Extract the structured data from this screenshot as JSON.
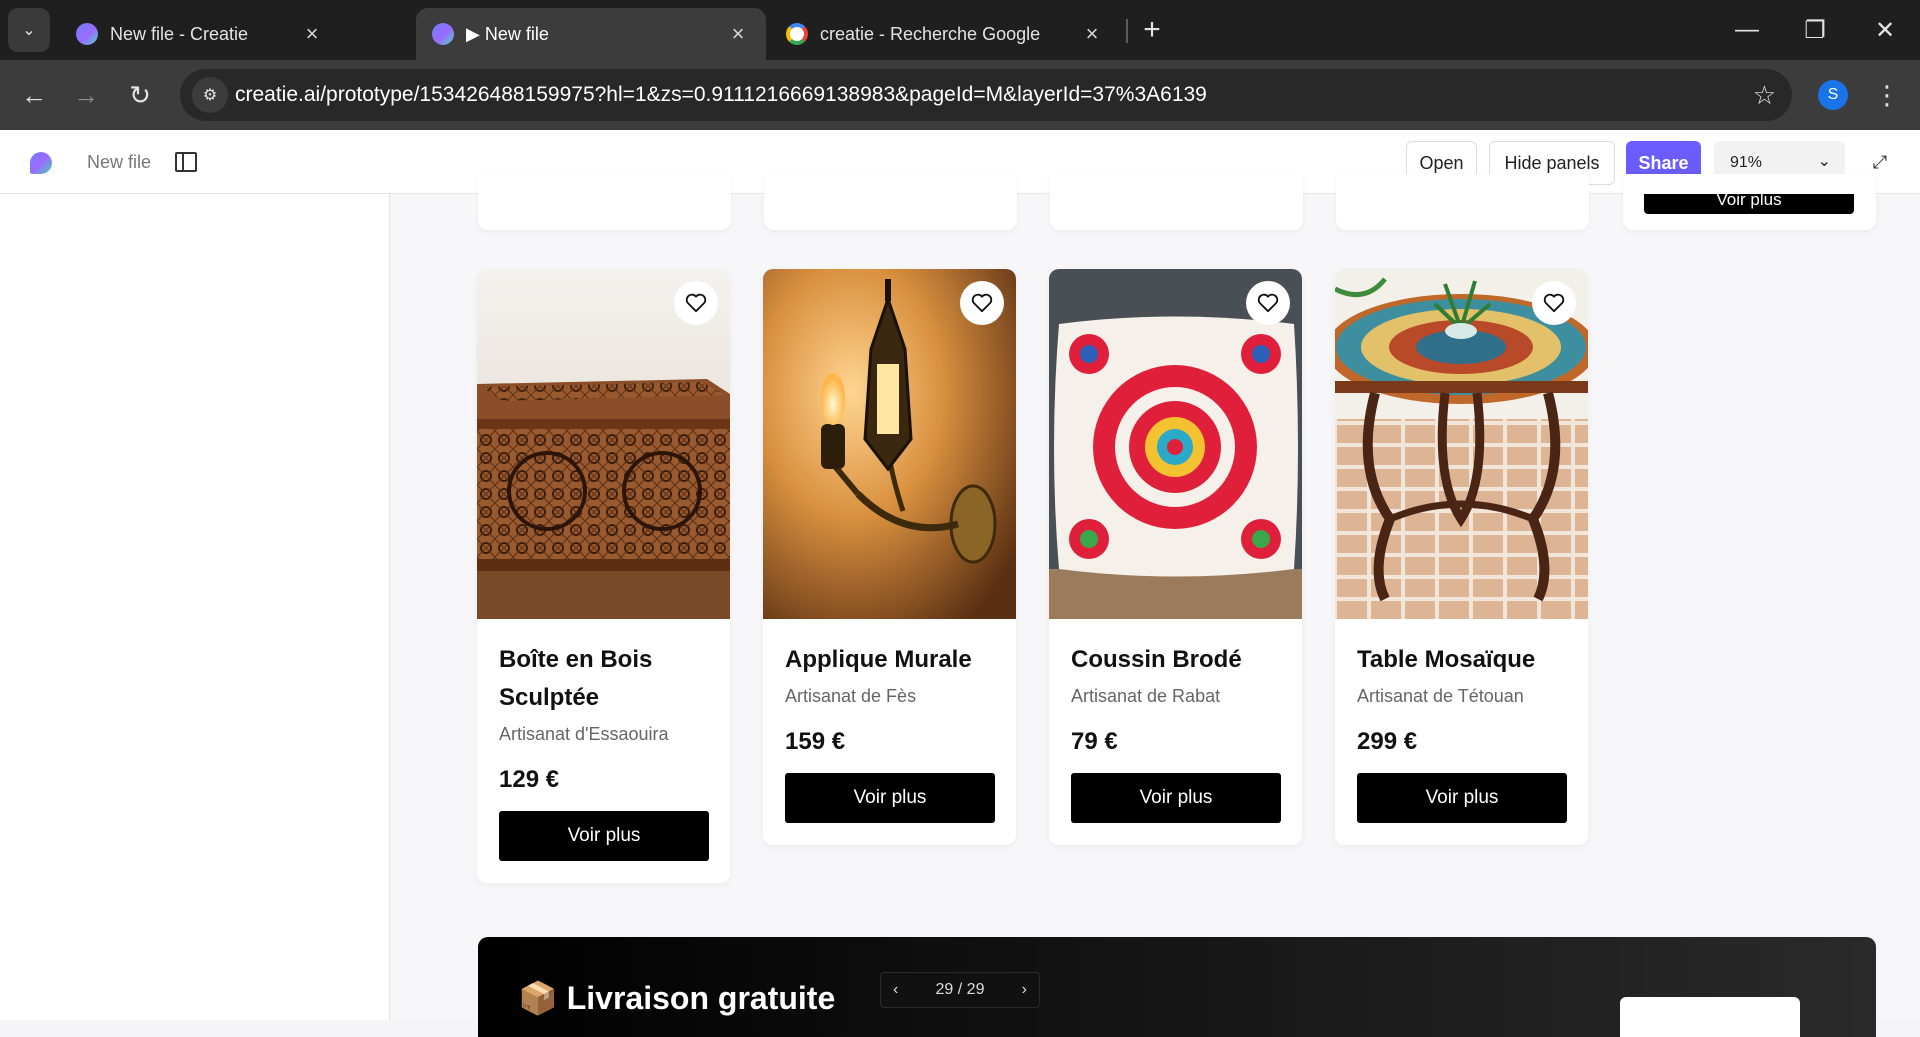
{
  "browser": {
    "tabs": [
      {
        "title": "New file - Creatie",
        "active": false
      },
      {
        "title": "▶ New file",
        "active": true
      },
      {
        "title": "creatie - Recherche Google",
        "active": false
      }
    ],
    "url": "creatie.ai/prototype/153426488159975?hl=1&zs=0.9111216669138983&pageId=M&layerId=37%3A6139",
    "profile_initial": "S"
  },
  "app": {
    "file_name": "New file",
    "open_label": "Open",
    "hide_panels_label": "Hide panels",
    "share_label": "Share",
    "zoom": "91%"
  },
  "top_row": {
    "partial_button_label": "Voir plus"
  },
  "products": [
    {
      "name": "Boîte en Bois Sculptée",
      "origin": "Artisanat d'Essaouira",
      "price": "129 €",
      "button": "Voir plus",
      "image": "carved-wooden-box"
    },
    {
      "name": "Applique Murale",
      "origin": "Artisanat de Fès",
      "price": "159 €",
      "button": "Voir plus",
      "image": "brass-wall-lamp"
    },
    {
      "name": "Coussin Brodé",
      "origin": "Artisanat de Rabat",
      "price": "79 €",
      "button": "Voir plus",
      "image": "embroidered-cushion"
    },
    {
      "name": "Table Mosaïque",
      "origin": "Artisanat de Tétouan",
      "price": "299 €",
      "button": "Voir plus",
      "image": "mosaic-table"
    }
  ],
  "promo": {
    "icon": "📦",
    "title": "Livraison gratuite"
  },
  "pager": {
    "label": "29 / 29"
  },
  "colors": {
    "accent": "#6b5cff",
    "button_dark": "#000000",
    "browser_chrome": "#1f1f1f"
  }
}
